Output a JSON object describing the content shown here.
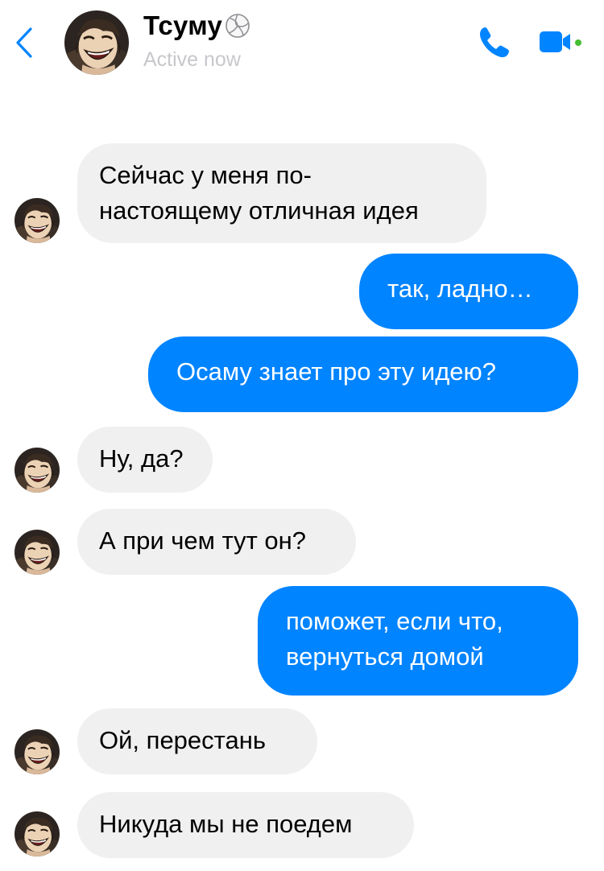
{
  "header": {
    "contact_name": "Тсуму",
    "contact_status": "Active now",
    "back_icon": "chevron-left-icon",
    "call_icon": "phone-icon",
    "video_icon": "video-camera-icon",
    "badge_icon": "volleyball-icon",
    "accent_color": "#0084ff",
    "online_color": "#44bd32"
  },
  "messages": [
    {
      "sender": "contact",
      "lines": [
        "Сейчас у меня по-",
        "настоящему отличная идея"
      ]
    },
    {
      "sender": "me",
      "lines": [
        "так, ладно…"
      ]
    },
    {
      "sender": "me",
      "lines": [
        "Осаму знает про эту идею?"
      ]
    },
    {
      "sender": "contact",
      "lines": [
        "Ну, да?"
      ]
    },
    {
      "sender": "contact",
      "lines": [
        "А при чем тут он?"
      ]
    },
    {
      "sender": "me",
      "lines": [
        "поможет, если что,",
        "вернуться домой"
      ]
    },
    {
      "sender": "contact",
      "lines": [
        "Ой, перестань"
      ]
    },
    {
      "sender": "contact",
      "lines": [
        "Никуда мы не поедем"
      ]
    }
  ],
  "colors": {
    "incoming_bubble": "#f0f0f0",
    "outgoing_bubble": "#0084ff",
    "status_text": "#c7c7cc"
  }
}
